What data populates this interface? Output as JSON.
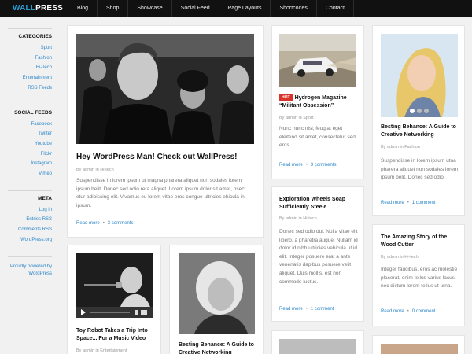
{
  "brand": {
    "part1": "WALL",
    "part2": "PRESS"
  },
  "nav": [
    "Blog",
    "Shop",
    "Showcase",
    "Social Feed",
    "Page Layouts",
    "Shortcodes",
    "Contact"
  ],
  "sidebar": {
    "categories": {
      "title": "CATEGORIES",
      "items": [
        "Sport",
        "Fashion",
        "Hi-Tech",
        "Entertainment",
        "RSS Feeds"
      ]
    },
    "social": {
      "title": "SOCIAL FEEDS",
      "items": [
        "Facebook",
        "Twitter",
        "Youtube",
        "Flickr",
        "Instagram",
        "Vimeo"
      ]
    },
    "meta": {
      "title": "META",
      "items": [
        "Log in",
        "Entries RSS",
        "Comments RSS",
        "WordPress.org"
      ]
    },
    "powered": "Proudly powered by WordPress"
  },
  "posts": {
    "main": {
      "title": "Hey WordPress Man! Check out WallPress!",
      "meta": "By admin in Hi-tech",
      "excerpt": "Suspendisse in lorem ipsum ut magna pharera aliquet non sodales lorem ipsum belit. Donec sed odio rera aliquet. Lorem ipsum dolor sit amet, nsect etur adipiscing elit. Vivamus eu lorem vitae eros congue ultricies ehicula in ipsum.",
      "read_more": "Read more",
      "comments": "3 comments"
    },
    "robot": {
      "title": "Toy Robot Takes a Trip Into Space... For a Music Video",
      "meta": "By admin in Entertainment"
    },
    "behance_left": {
      "title": "Besting Behance: A Guide to Creative Networking"
    },
    "hydrogen": {
      "badge": "HOT",
      "title": "Hydrogen Magazine “Militant Obsession”",
      "meta": "By admin in Sport",
      "excerpt": "Nunc nunc nisl, feugiat eget eleifend sit amet, consectetur sed eros.",
      "read_more": "Read more",
      "comments": "3 comments"
    },
    "wheels": {
      "title": "Exploration Wheels Soap Sufficiently Steele",
      "meta": "By admin in Hi-tech",
      "excerpt": "Donec sed odio dui. Nulla vitae elit libero, a pharetra augue. Nullam id dolor id nibh ultricies vehicula ut id elit. Integer posuere erat a ante venenatis dapibus posuere velit aliquet. Duis mollis, est non commodo luctus.",
      "read_more": "Read more",
      "comments": "1 comment"
    },
    "behance_right": {
      "title": "Besting Behance: A Guide to Creative Networking",
      "meta": "By admin in Fashion",
      "excerpt": "Suspendisse in lorem ipsum utna pharera aliquet non sodales lorem ipsum belit. Donec sed odio.",
      "read_more": "Read more",
      "comments": "1 comment"
    },
    "wood": {
      "title": "The Amazing Story of the Wood Cutter",
      "meta": "By admin in Hi-tech",
      "excerpt": "Integer faucibus, eros ac molestie placerat, enim tellus varius lacus, nec dictum lorem tellus ut urna.",
      "read_more": "Read more",
      "comments": "0 comment"
    }
  }
}
